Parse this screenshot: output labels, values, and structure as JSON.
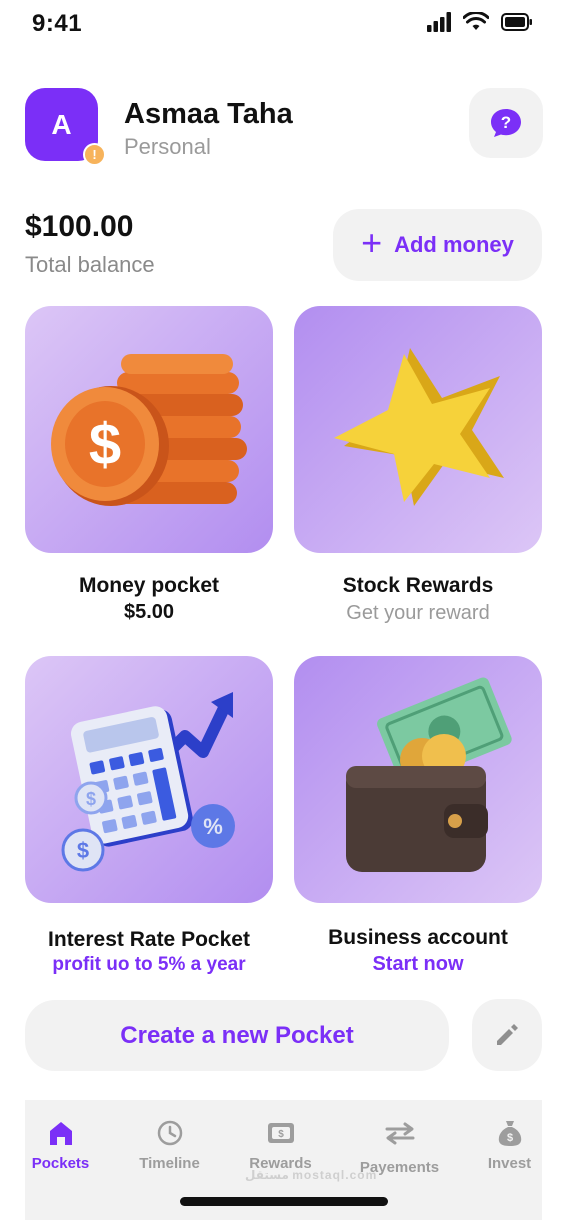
{
  "status_bar": {
    "time": "9:41"
  },
  "header": {
    "avatar_initial": "A",
    "avatar_badge": "!",
    "user_name": "Asmaa Taha",
    "account_type": "Personal",
    "help_icon": "question-bubble-icon"
  },
  "balance": {
    "amount": "$100.00",
    "label": "Total balance",
    "add_money_label": "Add money",
    "add_money_icon": "plus-icon"
  },
  "pockets": [
    {
      "title": "Money pocket",
      "subtitle": "$5.00",
      "illustration": "coin-stack"
    },
    {
      "title": "Stock Rewards",
      "subtitle": "Get your reward",
      "illustration": "star"
    },
    {
      "title": "Interest Rate Pocket",
      "subtitle": "profit uo to 5% a year",
      "illustration": "calculator-chart"
    },
    {
      "title": "Business account",
      "subtitle": "Start now",
      "illustration": "wallet"
    }
  ],
  "create_pocket_label": "Create a new Pocket",
  "tabs": [
    {
      "label": "Pockets",
      "icon": "home-icon",
      "active": true
    },
    {
      "label": "Timeline",
      "icon": "clock-icon",
      "active": false
    },
    {
      "label": "Rewards",
      "icon": "rewards-icon",
      "active": false
    },
    {
      "label": "Payements",
      "icon": "transfer-icon",
      "active": false
    },
    {
      "label": "Invest",
      "icon": "money-bag-icon",
      "active": false
    }
  ],
  "watermark": "مستقل mostaql.com",
  "colors": {
    "accent": "#7b2ff7",
    "card_light": "#dcc6f6",
    "card_dark": "#b28ef0",
    "badge": "#f7b35b"
  }
}
